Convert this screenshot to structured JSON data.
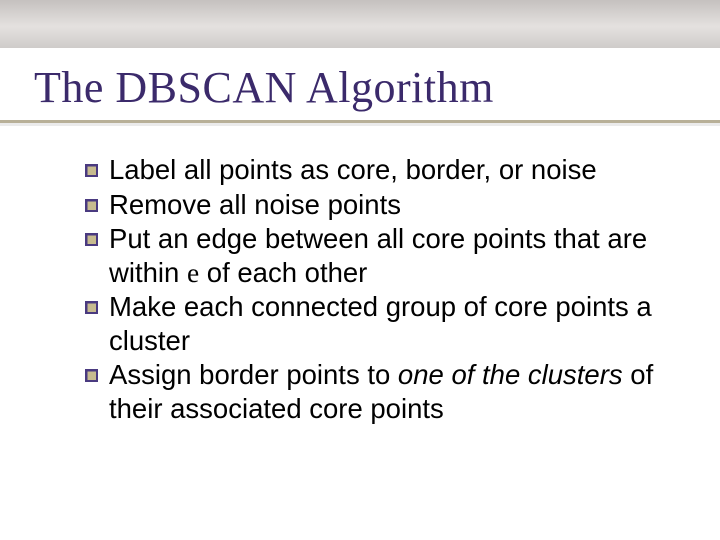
{
  "title": "The DBSCAN Algorithm",
  "bullets": {
    "b1": "Label all points as core, border, or noise",
    "b2": "Remove all noise points",
    "b3_pre": "Put an edge between all core points that are within ",
    "b3_eps": "e",
    "b3_post": " of each other",
    "b4": "Make each connected group of core points a cluster",
    "b5_pre": "Assign border points to ",
    "b5_italic": "one of the clusters",
    "b5_post": " of their associated core points"
  }
}
